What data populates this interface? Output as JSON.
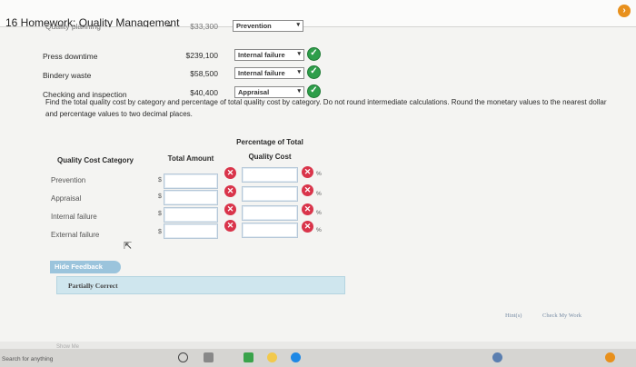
{
  "window": {
    "title": "16 Homework: Quality Management"
  },
  "top_partial": {
    "label": "Quality planning",
    "amount": "$33,300",
    "select": "Prevention"
  },
  "rows": [
    {
      "label": "Press downtime",
      "amount": "$239,100",
      "select": "Internal failure"
    },
    {
      "label": "Bindery waste",
      "amount": "$58,500",
      "select": "Internal failure"
    },
    {
      "label": "Checking and inspection",
      "amount": "$40,400",
      "select": "Appraisal"
    }
  ],
  "instructions": "Find the total quality cost by category and percentage of total quality cost by category. Do not round intermediate calculations. Round the monetary values to the nearest dollar and percentage values to two decimal places.",
  "table": {
    "col_category": "Quality Cost Category",
    "col_amount": "Total Amount",
    "col_pct_line1": "Percentage of Total",
    "col_pct_line2": "Quality Cost",
    "currency": "$",
    "pct_sign": "%",
    "categories": [
      "Prevention",
      "Appraisal",
      "Internal failure",
      "External failure"
    ]
  },
  "feedback": {
    "toggle": "Hide Feedback",
    "status": "Partially Correct"
  },
  "links": {
    "hint": "Hint(s)",
    "check": "Check My Work"
  },
  "prev_link": "Show Me",
  "taskbar": {
    "search": "Search for anything"
  },
  "colors": {
    "correct": "#2e9e4a",
    "incorrect": "#d9344a",
    "feedback_panel": "#cfe6ee"
  },
  "icons": {
    "correct": "check-circle-icon",
    "incorrect": "x-circle-icon"
  }
}
